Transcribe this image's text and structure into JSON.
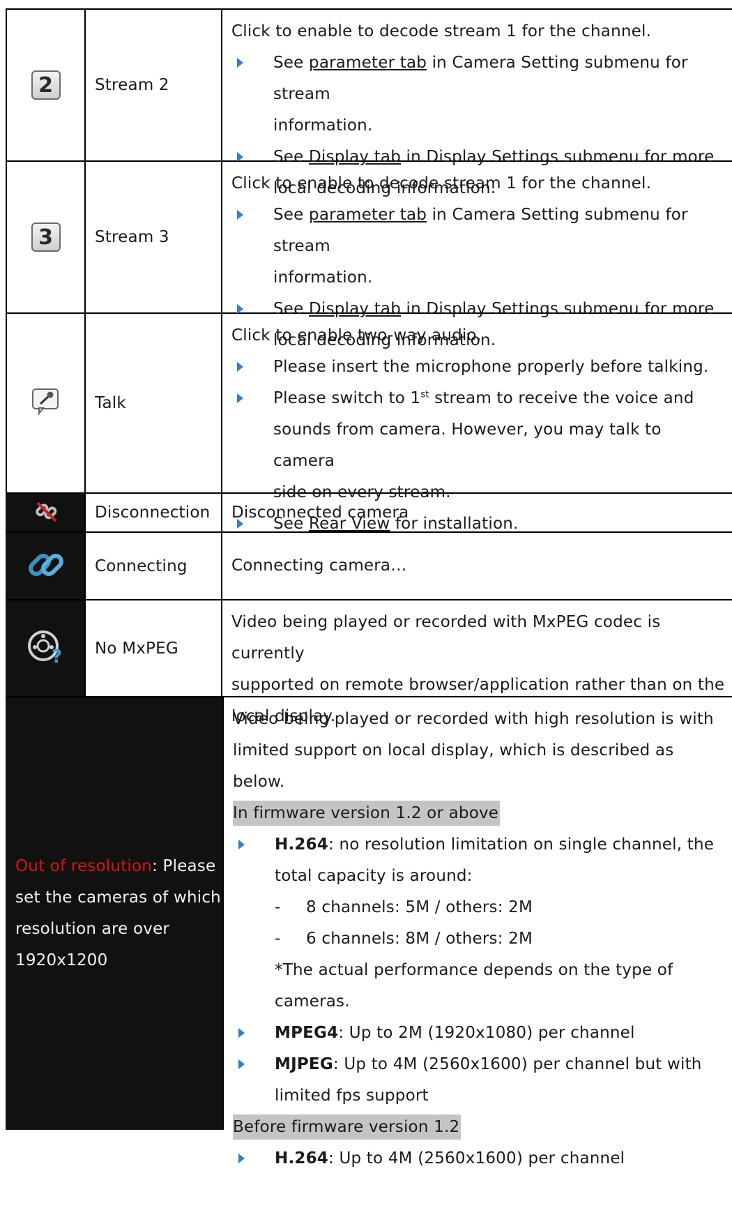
{
  "rows": [
    {
      "icon": "stream-2-icon",
      "icon_text": "2",
      "name": "Stream 2",
      "intro": "Click to enable to decode stream 1 for the channel.",
      "b1_pre": "See ",
      "b1_link": "parameter tab",
      "b1_post": " in Camera Setting submenu for stream",
      "b1_cont": "information.",
      "b2_pre": "See ",
      "b2_link": "Display tab",
      "b2_post": " in Display Settings submenu for more",
      "b2_cont": "local decoding information."
    },
    {
      "icon": "stream-3-icon",
      "icon_text": "3",
      "name": "Stream 3",
      "intro": "Click to enable to decode stream 1 for the channel.",
      "b1_pre": "See ",
      "b1_link": "parameter tab",
      "b1_post": " in Camera Setting submenu for stream",
      "b1_cont": "information.",
      "b2_pre": "See ",
      "b2_link": "Display tab",
      "b2_post": " in Display Settings submenu for more",
      "b2_cont": "local decoding information."
    }
  ],
  "talk": {
    "icon": "microphone-bubble-icon",
    "name": "Talk",
    "intro": "Click to enable two-way audio.",
    "b1": "Please insert the microphone properly before talking.",
    "b2_pre": "Please switch to 1",
    "b2_sup": "st",
    "b2_post": " stream to receive the voice and",
    "b2_cont1": "sounds from camera. However, you may talk to camera",
    "b2_cont2": "side on every stream.",
    "b3_pre": "See ",
    "b3_link": "Rear View",
    "b3_post": " for installation."
  },
  "disconnection": {
    "icon": "broken-link-icon",
    "name": "Disconnection",
    "desc": "Disconnected camera"
  },
  "connecting": {
    "icon": "chain-link-icon",
    "name": "Connecting",
    "desc": "Connecting camera…"
  },
  "nomxpeg": {
    "icon": "film-question-icon",
    "name": "No MxPEG",
    "desc1": "Video being played or recorded with MxPEG codec is currently",
    "desc2": "supported on remote browser/application rather than on the",
    "desc3": "local display."
  },
  "resolution": {
    "label_red": "Out of resolution",
    "label_rest1": ": Please",
    "label_line2": "set the cameras of which",
    "label_line3": "resolution are over",
    "label_line4": "1920x1200",
    "intro1": "Video being played or recorded with high resolution is with",
    "intro2": "limited support on local display, which is described as below.",
    "fw_new": "In firmware version 1.2 or above",
    "h264_bold": "H.264",
    "h264_text": ": no resolution limitation on single channel, the",
    "h264_cont": "total capacity is around:",
    "dash1": "-",
    "sub1": "8 channels: 5M / others: 2M",
    "dash2": "-",
    "sub2": "6 channels: 8M / others: 2M",
    "note1": "*The actual performance depends on the type of",
    "note2": "cameras.",
    "mpeg4_bold": "MPEG4",
    "mpeg4_text": ": Up to 2M (1920x1080) per channel",
    "mjpeg_bold": "MJPEG",
    "mjpeg_text": ": Up to 4M (2560x1600) per channel but with",
    "mjpeg_cont": "limited fps support",
    "fw_old": "Before firmware version 1.2",
    "h264b_bold": "H.264",
    "h264b_text": ": Up to 4M (2560x1600) per channel"
  },
  "colors": {
    "accent_red": "#e01010",
    "bullet_blue": "#2f7fd0",
    "dark_cell": "#111111",
    "highlight": "#c4c4c4"
  }
}
